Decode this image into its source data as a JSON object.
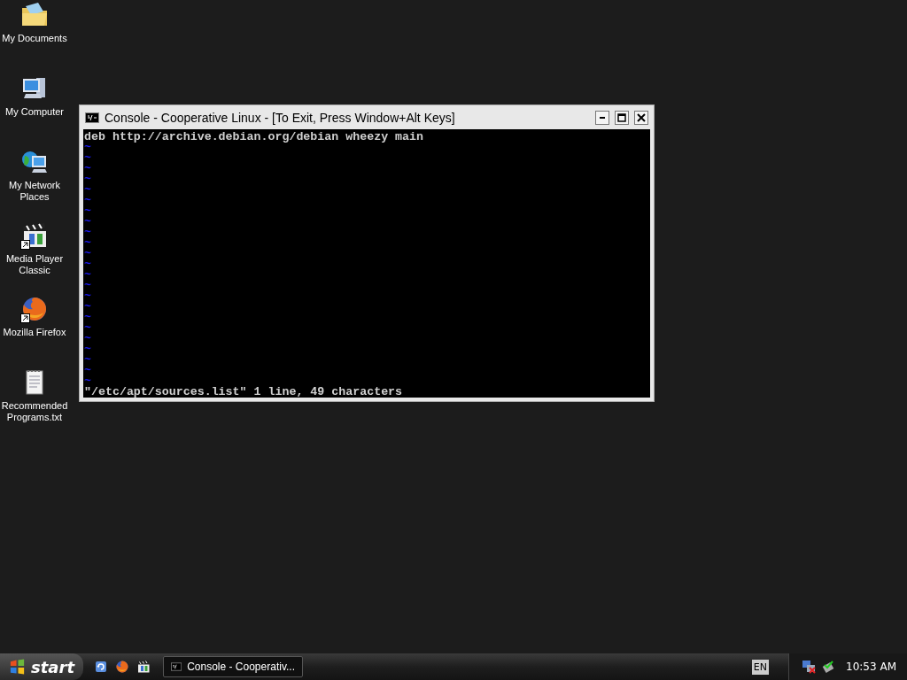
{
  "desktop_icons": [
    {
      "kind": "folder",
      "label": "My Documents",
      "shortcut": false
    },
    {
      "kind": "computer",
      "label": "My Computer",
      "shortcut": false
    },
    {
      "kind": "network",
      "label": "My Network Places",
      "shortcut": false
    },
    {
      "kind": "clapper",
      "label": "Media Player Classic",
      "shortcut": true
    },
    {
      "kind": "firefox",
      "label": "Mozilla Firefox",
      "shortcut": true
    },
    {
      "kind": "notepad",
      "label": "Recommended Programs.txt",
      "shortcut": false
    }
  ],
  "window": {
    "title": "Console - Cooperative Linux - [To Exit, Press Window+Alt Keys]",
    "lines": [
      "deb http://archive.debian.org/debian wheezy main"
    ],
    "empty_lines": [
      "~",
      "~",
      "~",
      "~",
      "~",
      "~",
      "~",
      "~",
      "~",
      "~",
      "~",
      "~",
      "~",
      "~",
      "~",
      "~",
      "~",
      "~",
      "~",
      "~",
      "~",
      "~",
      "~"
    ],
    "status": "\"/etc/apt/sources.list\" 1 line, 49 characters"
  },
  "taskbar": {
    "start": "start",
    "quick_launch": [
      {
        "kind": "refresh"
      },
      {
        "kind": "firefox"
      },
      {
        "kind": "clapper"
      }
    ],
    "tasks": [
      {
        "label": "Console - Cooperativ...",
        "selected": false
      }
    ],
    "language": "EN",
    "clock": "10:53 AM"
  }
}
